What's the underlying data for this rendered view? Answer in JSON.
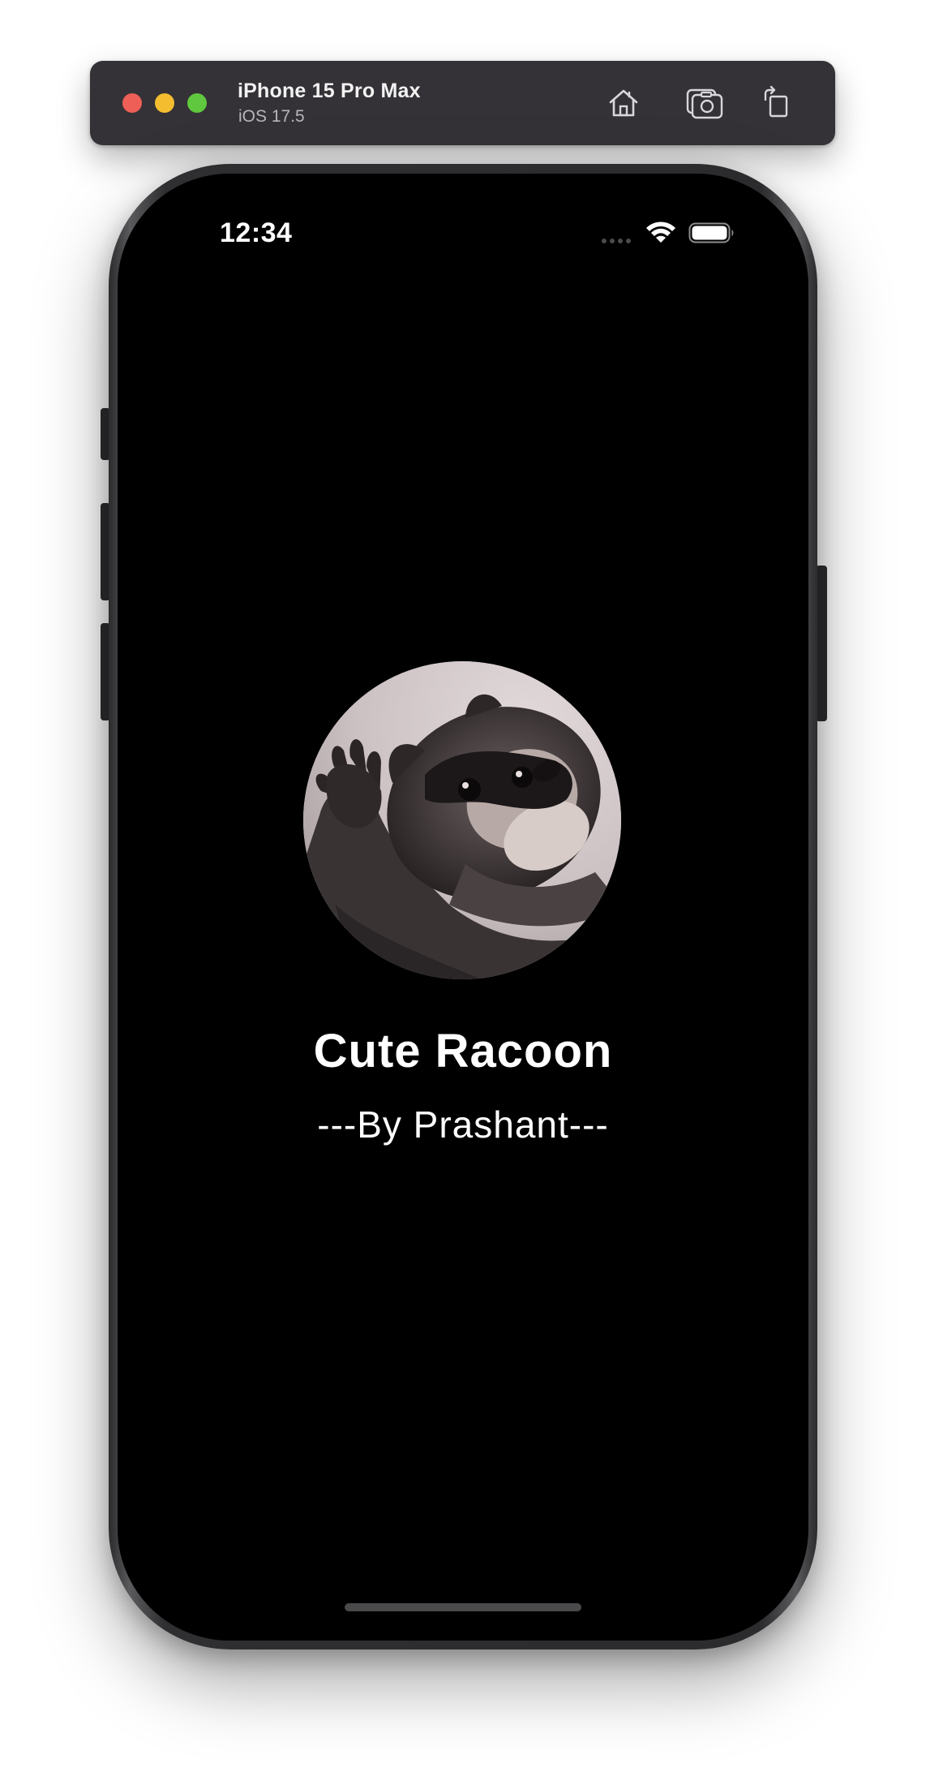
{
  "simulator": {
    "device_name": "iPhone 15 Pro Max",
    "os_version": "iOS 17.5",
    "buttons": {
      "home_icon": "home-icon",
      "screenshot_icon": "camera-icon",
      "rotate_icon": "rotate-icon"
    },
    "traffic_lights": {
      "close": "#ee5f57",
      "minimize": "#f4bd2f",
      "zoom": "#5fc83e"
    }
  },
  "status_bar": {
    "time": "12:34",
    "cellular_icon": "cellular-dots-icon",
    "wifi_icon": "wifi-icon",
    "battery_icon": "battery-full-icon"
  },
  "app": {
    "image_subject": "racoon waving",
    "title": "Cute Racoon",
    "subtitle": "---By Prashant---",
    "background_color": "#000000",
    "text_color": "#ffffff"
  }
}
